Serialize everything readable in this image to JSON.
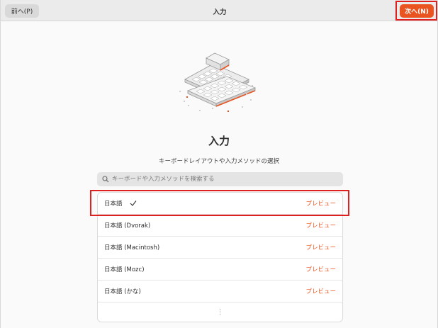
{
  "header": {
    "back_label": "前へ(P)",
    "title": "入力",
    "next_label": "次へ(N)"
  },
  "main": {
    "heading": "入力",
    "subtitle": "キーボードレイアウトや入力メソッドの選択",
    "search_placeholder": "キーボードや入力メソッドを検索する",
    "more_label": "⋮"
  },
  "layouts": [
    {
      "label": "日本語",
      "preview": "プレビュー",
      "selected": true
    },
    {
      "label": "日本語 (Dvorak)",
      "preview": "プレビュー",
      "selected": false
    },
    {
      "label": "日本語 (Macintosh)",
      "preview": "プレビュー",
      "selected": false
    },
    {
      "label": "日本語 (Mozc)",
      "preview": "プレビュー",
      "selected": false
    },
    {
      "label": "日本語 (かな)",
      "preview": "プレビュー",
      "selected": false
    }
  ],
  "colors": {
    "accent": "#e95420",
    "highlight": "#e01f1f"
  }
}
